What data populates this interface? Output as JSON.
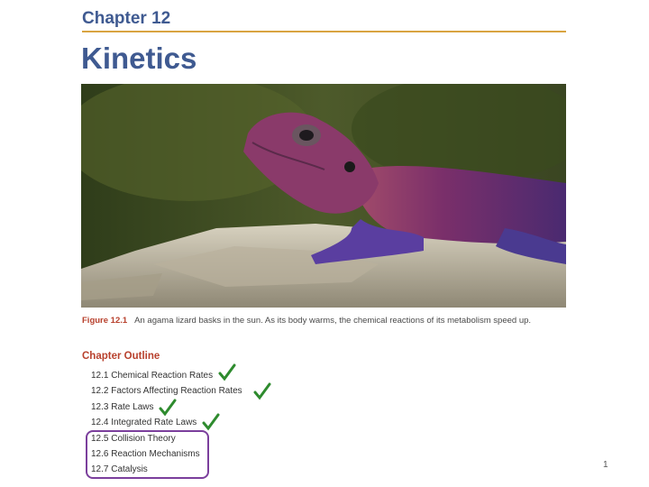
{
  "header": {
    "chapter": "Chapter 12",
    "title": "Kinetics"
  },
  "figure": {
    "label": "Figure 12.1",
    "caption": "An agama lizard basks in the sun. As its body warms, the chemical reactions of its metabolism speed up."
  },
  "outline": {
    "heading": "Chapter Outline",
    "items": [
      "12.1 Chemical Reaction Rates",
      "12.2 Factors Affecting Reaction Rates",
      "12.3 Rate Laws",
      "12.4 Integrated Rate Laws",
      "12.5 Collision Theory",
      "12.6 Reaction Mechanisms",
      "12.7 Catalysis"
    ],
    "checked_items": [
      "12.1",
      "12.2",
      "12.3",
      "12.4"
    ],
    "highlighted_items": [
      "12.5",
      "12.6",
      "12.7"
    ]
  },
  "colors": {
    "title": "#3f5a91",
    "rule": "#d9a441",
    "accent_red": "#b8412d",
    "check": "#2e8b2e",
    "highlight_box": "#7b3f9c"
  },
  "page_number": "1"
}
